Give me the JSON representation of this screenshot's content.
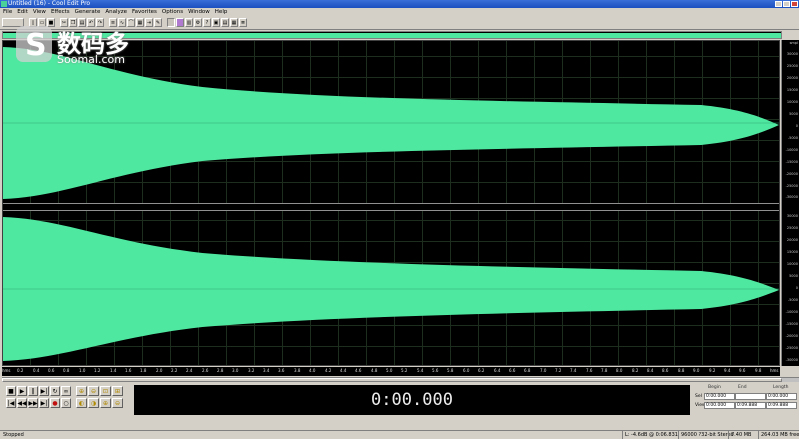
{
  "window": {
    "title": "Untitled (16) - Cool Edit Pro"
  },
  "menu": [
    "File",
    "Edit",
    "View",
    "Effects",
    "Generate",
    "Analyze",
    "Favorites",
    "Options",
    "Window",
    "Help"
  ],
  "toolbar": {
    "icons": [
      "new-icon",
      "open-icon",
      "save-icon",
      "cut-icon",
      "copy-icon",
      "paste-icon",
      "undo-icon",
      "redo-icon",
      "mix-icon",
      "edit-view-icon",
      "envelope-icon",
      "spectral-icon",
      "cue-icon",
      "script-icon",
      "batch-icon",
      "tools-icon",
      "meters-icon",
      "settings-icon",
      "help-icon"
    ]
  },
  "timeline": {
    "labels": [
      "hms",
      "0.2",
      "0.4",
      "0.6",
      "0.8",
      "1.0",
      "1.2",
      "1.4",
      "1.6",
      "1.8",
      "2.0",
      "2.2",
      "2.4",
      "2.6",
      "2.8",
      "3.0",
      "3.2",
      "3.4",
      "3.6",
      "3.8",
      "4.0",
      "4.2",
      "4.4",
      "4.6",
      "4.8",
      "5.0",
      "5.2",
      "5.4",
      "5.6",
      "5.8",
      "6.0",
      "6.2",
      "6.4",
      "6.6",
      "6.8",
      "7.0",
      "7.2",
      "7.4",
      "7.6",
      "7.8",
      "8.0",
      "8.2",
      "8.4",
      "8.6",
      "8.8",
      "9.0",
      "9.2",
      "9.4",
      "9.6",
      "9.8",
      "hms"
    ]
  },
  "amplitude_ruler": {
    "left_channel": [
      "smpl",
      "30000",
      "25000",
      "20000",
      "15000",
      "10000",
      "5000",
      "0",
      "-5000",
      "-10000",
      "-15000",
      "-20000",
      "-25000",
      "-30000"
    ],
    "right_channel": [
      "30000",
      "25000",
      "20000",
      "15000",
      "10000",
      "5000",
      "0",
      "-5000",
      "-10000",
      "-15000",
      "-20000",
      "-25000",
      "-30000"
    ]
  },
  "waveform": {
    "color": "#4ee8a0",
    "background": "#000000"
  },
  "transport": {
    "buttons": [
      "stop-icon",
      "play-icon",
      "pause-icon",
      "play-to-end-icon",
      "loop-icon",
      "skip-icon",
      "go-start-icon",
      "rewind-icon",
      "fast-forward-icon",
      "go-end-icon",
      "record-icon",
      "record-pause-icon"
    ]
  },
  "zoom": {
    "buttons": [
      "zoom-in-h-icon",
      "zoom-out-h-icon",
      "zoom-full-icon",
      "zoom-sel-icon",
      "zoom-left-icon",
      "zoom-right-icon",
      "zoom-in-v-icon",
      "zoom-out-v-icon"
    ]
  },
  "time_display": "0:00.000",
  "selection": {
    "headers": {
      "begin": "Begin",
      "end": "End",
      "length": "Length"
    },
    "rows": [
      {
        "label": "Sel",
        "begin": "0:00.000",
        "end": "",
        "length": "0:00.000"
      },
      {
        "label": "View",
        "begin": "0:00.000",
        "end": "0:09.888",
        "length": "0:09.888"
      }
    ]
  },
  "status": {
    "text": "Stopped",
    "cells": [
      "L: -4.6dB @ 0:06.831",
      "96000 ?32-bit Stereo",
      "7.40 MB",
      "264.03 MB free"
    ]
  },
  "watermark": {
    "chinese": "数码多",
    "english": "Soomal.com"
  }
}
